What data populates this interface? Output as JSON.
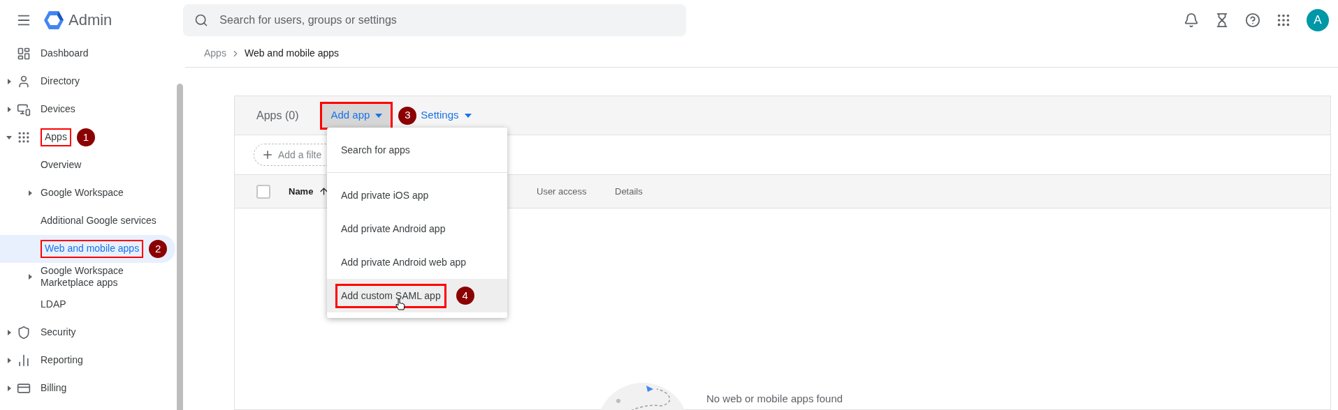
{
  "header": {
    "app_name": "Admin",
    "search": {
      "placeholder": "Search for users, groups or settings"
    },
    "avatar": "A"
  },
  "breadcrumb": [
    {
      "label": "Apps",
      "current": false
    },
    {
      "label": "Web and mobile apps",
      "current": true
    }
  ],
  "sidebar": {
    "items": [
      {
        "label": "Dashboard",
        "kind": "dashboard",
        "selected": false
      },
      {
        "label": "Directory",
        "kind": "directory",
        "expanded": false,
        "selected": false
      },
      {
        "label": "Devices",
        "kind": "devices",
        "expanded": false,
        "selected": false
      },
      {
        "label": "Apps",
        "kind": "apps",
        "expanded": true,
        "selected": false,
        "callout": "1",
        "children": [
          {
            "label": "Overview",
            "selected": false
          },
          {
            "label": "Google Workspace",
            "expanded": false,
            "selected": false
          },
          {
            "label": "Additional Google services",
            "selected": false
          },
          {
            "label": "Web and mobile apps",
            "selected": true,
            "callout": "2"
          },
          {
            "label": "Google Workspace Marketplace apps",
            "expanded": false,
            "selected": false
          },
          {
            "label": "LDAP",
            "selected": false
          }
        ]
      },
      {
        "label": "Security",
        "kind": "security",
        "expanded": false,
        "selected": false
      },
      {
        "label": "Reporting",
        "kind": "reporting",
        "expanded": false,
        "selected": false
      },
      {
        "label": "Billing",
        "kind": "billing",
        "expanded": false,
        "selected": false
      }
    ]
  },
  "card": {
    "title": "Apps (0)",
    "toolbar": [
      {
        "label": "Add app",
        "pressed": true,
        "callout": "3"
      },
      {
        "label": "Settings",
        "pressed": false
      }
    ],
    "filter_chip": "Add a filte",
    "table": {
      "columns": [
        {
          "label": "Name",
          "sorted": true
        },
        {
          "label": "User access",
          "sorted": false
        },
        {
          "label": "Details",
          "sorted": false
        }
      ],
      "all_checked": false
    },
    "empty_message": "No web or mobile apps found"
  },
  "menu": {
    "sections": [
      {
        "items": [
          {
            "label": "Search for apps",
            "hovered": false
          }
        ]
      },
      {
        "items": [
          {
            "label": "Add private iOS app",
            "hovered": false
          },
          {
            "label": "Add private Android app",
            "hovered": false
          },
          {
            "label": "Add private Android web app",
            "hovered": false
          },
          {
            "label": "Add custom SAML app",
            "hovered": true,
            "callout": "4"
          }
        ]
      }
    ]
  }
}
